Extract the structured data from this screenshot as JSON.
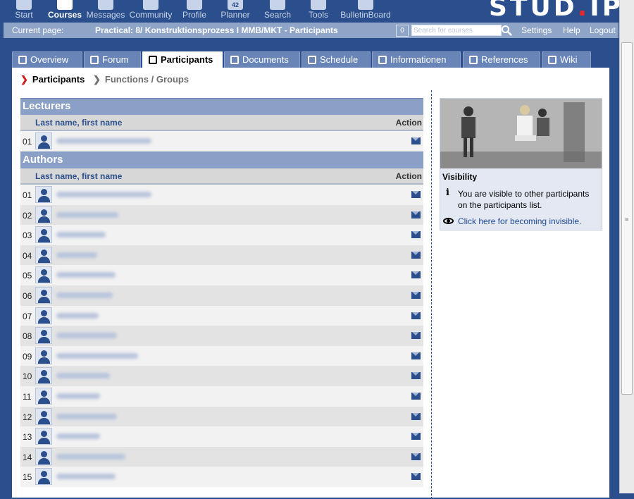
{
  "nav": {
    "items": [
      {
        "label": "Start",
        "icon": "home-icon"
      },
      {
        "label": "Courses",
        "icon": "courses-icon",
        "active": true
      },
      {
        "label": "Messages",
        "icon": "envelope-icon"
      },
      {
        "label": "Community",
        "icon": "community-icon"
      },
      {
        "label": "Profile",
        "icon": "profile-icon"
      },
      {
        "label": "Planner",
        "icon": "calendar-icon",
        "badge": "42"
      },
      {
        "label": "Search",
        "icon": "search-icon"
      },
      {
        "label": "Tools",
        "icon": "tools-icon"
      },
      {
        "label": "BulletinBoard",
        "icon": "bulletin-icon"
      }
    ],
    "logo_text": "STUD.IP"
  },
  "breadcrumb": {
    "label": "Current page:",
    "title": "Practical: 8/ Konstruktionsprozess I MMB/MKT - Participants",
    "count": "0",
    "search_placeholder": "Search for courses",
    "links": [
      "Settings",
      "Help",
      "Logout"
    ]
  },
  "tabs": [
    {
      "label": "Overview",
      "icon": "overview-icon"
    },
    {
      "label": "Forum",
      "icon": "forum-icon"
    },
    {
      "label": "Participants",
      "icon": "participants-icon",
      "active": true
    },
    {
      "label": "Documents",
      "icon": "documents-icon"
    },
    {
      "label": "Schedule",
      "icon": "schedule-icon"
    },
    {
      "label": "Informationen",
      "icon": "info-icon"
    },
    {
      "label": "References",
      "icon": "references-icon"
    },
    {
      "label": "Wiki",
      "icon": "wiki-icon"
    }
  ],
  "subnav": {
    "items": [
      {
        "label": "Participants",
        "active": true
      },
      {
        "label": "Functions / Groups",
        "active": false
      }
    ]
  },
  "lecturers": {
    "title": "Lecturers",
    "col_name": "Last name, first name",
    "col_action": "Action",
    "rows": [
      {
        "num": "01"
      }
    ]
  },
  "authors": {
    "title": "Authors",
    "col_name": "Last name, first name",
    "col_action": "Action",
    "rows": [
      {
        "num": "01"
      },
      {
        "num": "02"
      },
      {
        "num": "03"
      },
      {
        "num": "04"
      },
      {
        "num": "05"
      },
      {
        "num": "06"
      },
      {
        "num": "07"
      },
      {
        "num": "08"
      },
      {
        "num": "09"
      },
      {
        "num": "10"
      },
      {
        "num": "11"
      },
      {
        "num": "12"
      },
      {
        "num": "13"
      },
      {
        "num": "14"
      },
      {
        "num": "15"
      }
    ]
  },
  "visibility": {
    "title": "Visibility",
    "info_text": "You are visible to other participants on the participants list.",
    "link_text": "Click here for becoming invisible.",
    "icons": [
      "info-icon",
      "eye-icon"
    ]
  },
  "colors": {
    "header_bg": "#2b4f8c",
    "section_bg": "#8ba0c6",
    "link": "#1f4a92",
    "accent_red": "#d21b1b"
  }
}
